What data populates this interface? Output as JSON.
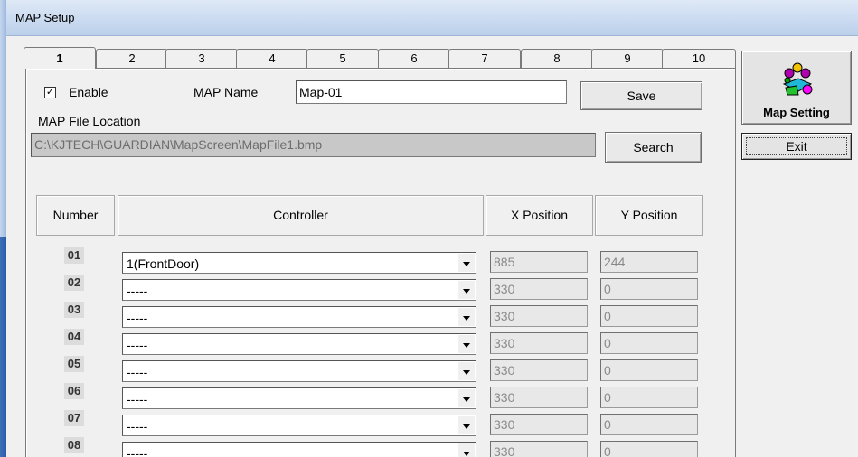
{
  "window": {
    "title": "MAP Setup"
  },
  "tabs": [
    "1",
    "2",
    "3",
    "4",
    "5",
    "6",
    "7",
    "8",
    "9",
    "10"
  ],
  "active_tab": "1",
  "form": {
    "enable_label": "Enable",
    "enable_checked": "✓",
    "map_name_label": "MAP Name",
    "map_name_value": "Map-01",
    "save_label": "Save",
    "file_location_label": "MAP File Location",
    "file_location_value": "C:\\KJTECH\\GUARDIAN\\MapScreen\\MapFile1.bmp",
    "search_label": "Search"
  },
  "table": {
    "headers": {
      "number": "Number",
      "controller": "Controller",
      "x": "X Position",
      "y": "Y Position"
    },
    "rows": [
      {
        "number": "01",
        "controller": "1(FrontDoor)",
        "x": "885",
        "y": "244"
      },
      {
        "number": "02",
        "controller": "-----",
        "x": "330",
        "y": "0"
      },
      {
        "number": "03",
        "controller": "-----",
        "x": "330",
        "y": "0"
      },
      {
        "number": "04",
        "controller": "-----",
        "x": "330",
        "y": "0"
      },
      {
        "number": "05",
        "controller": "-----",
        "x": "330",
        "y": "0"
      },
      {
        "number": "06",
        "controller": "-----",
        "x": "330",
        "y": "0"
      },
      {
        "number": "07",
        "controller": "-----",
        "x": "330",
        "y": "0"
      },
      {
        "number": "08",
        "controller": "-----",
        "x": "330",
        "y": "0"
      }
    ]
  },
  "side": {
    "map_setting_label": "Map Setting",
    "map_setting_icon": "map-pins-icon",
    "exit_label": "Exit"
  }
}
